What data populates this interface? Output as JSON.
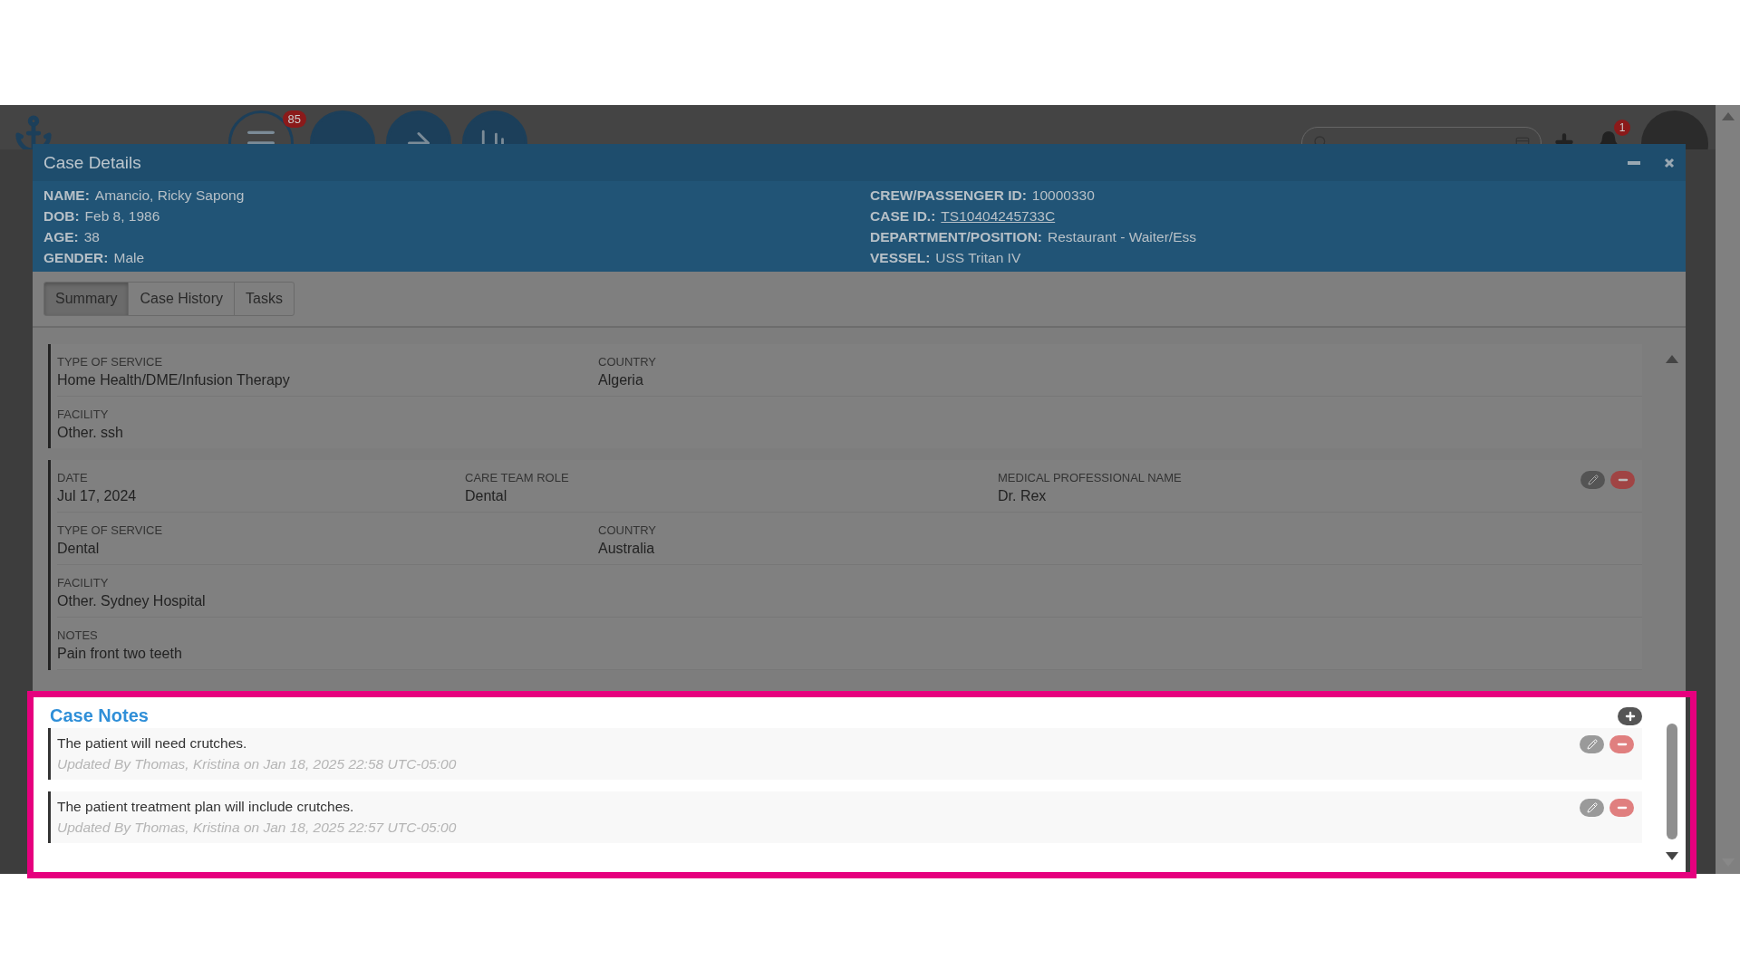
{
  "app_header": {
    "menu_badge": "85",
    "notification_badge": "1"
  },
  "modal": {
    "title": "Case Details",
    "patient_left": [
      {
        "label": "NAME:",
        "value": "Amancio, Ricky Sapong",
        "kind": "text"
      },
      {
        "label": "DOB:",
        "value": "Feb 8, 1986",
        "kind": "text"
      },
      {
        "label": "AGE:",
        "value": "38",
        "kind": "text"
      },
      {
        "label": "GENDER:",
        "value": "Male",
        "kind": "text"
      }
    ],
    "patient_right": [
      {
        "label": "CREW/PASSENGER ID:",
        "value": "10000330",
        "kind": "text"
      },
      {
        "label": "CASE ID.:",
        "value": "TS10404245733C",
        "kind": "link"
      },
      {
        "label": "DEPARTMENT/POSITION:",
        "value": "Restaurant - Waiter/Ess",
        "kind": "text"
      },
      {
        "label": "VESSEL:",
        "value": "USS Tritan IV",
        "kind": "text"
      }
    ]
  },
  "tabs": [
    {
      "label": "Summary",
      "selected": true
    },
    {
      "label": "Case History",
      "selected": false
    },
    {
      "label": "Tasks",
      "selected": false
    }
  ],
  "service_records": [
    {
      "editable": false,
      "rows": [
        [
          {
            "label": "TYPE OF SERVICE",
            "value": "Home Health/DME/Infusion Therapy"
          },
          {
            "label": "COUNTRY",
            "value": "Algeria"
          }
        ],
        [
          {
            "label": "FACILITY",
            "value": "Other. ssh"
          }
        ]
      ]
    },
    {
      "editable": true,
      "rows": [
        [
          {
            "label": "DATE",
            "value": "Jul 17, 2024"
          },
          {
            "label": "CARE TEAM ROLE",
            "value": "Dental"
          },
          {
            "label": "MEDICAL PROFESSIONAL NAME",
            "value": "Dr. Rex"
          }
        ],
        [
          {
            "label": "TYPE OF SERVICE",
            "value": "Dental"
          },
          {
            "label": "COUNTRY",
            "value": "Australia"
          }
        ],
        [
          {
            "label": "FACILITY",
            "value": "Other. Sydney Hospital"
          }
        ],
        [
          {
            "label": "NOTES",
            "value": "Pain front two teeth"
          }
        ]
      ]
    }
  ],
  "case_notes": {
    "title": "Case Notes",
    "notes": [
      {
        "text": "The patient will need crutches.",
        "meta": "Updated By Thomas, Kristina on Jan 18, 2025 22:58 UTC-05:00"
      },
      {
        "text": "The patient treatment plan will include crutches.",
        "meta": "Updated By Thomas, Kristina on Jan 18, 2025 22:57 UTC-05:00"
      }
    ]
  }
}
